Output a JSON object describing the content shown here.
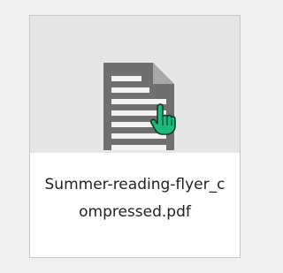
{
  "file": {
    "name": "Summer-reading-flyer_compressed.pdf",
    "icon": "document-icon"
  },
  "cursor": {
    "icon": "hand-pointer-icon",
    "color": "#1db97b"
  },
  "colors": {
    "page_background": "#f0f0f0",
    "tile_border": "#c9c9c9",
    "thumbnail_background": "#e6e6e6",
    "document_icon": "#6f6f6f",
    "text": "#222222"
  }
}
